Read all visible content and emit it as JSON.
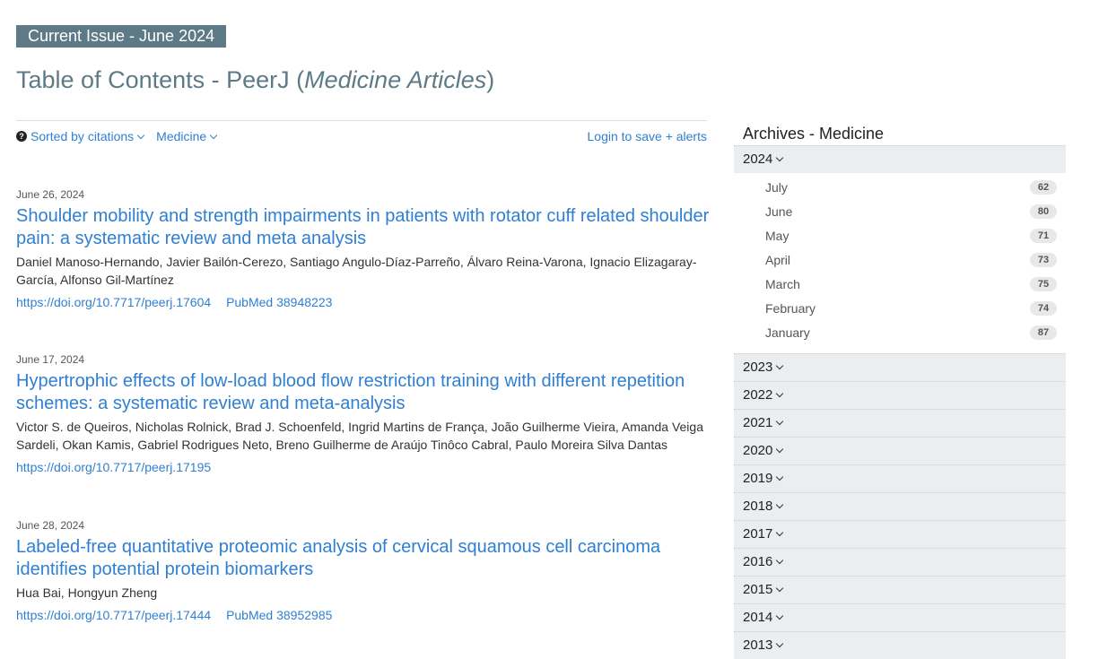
{
  "header": {
    "badge": "Current Issue - June 2024",
    "title_prefix": "Table of Contents - PeerJ (",
    "title_italic": "Medicine Articles",
    "title_suffix": ")"
  },
  "filters": {
    "help_glyph": "?",
    "sort_label": "Sorted by citations",
    "subject_label": "Medicine",
    "login_label": "Login to save + alerts"
  },
  "articles": [
    {
      "date": "June 26, 2024",
      "title": "Shoulder mobility and strength impairments in patients with rotator cuff related shoulder pain: a systematic review and meta analysis",
      "authors": "Daniel Manoso-Hernando, Javier Bailón-Cerezo, Santiago Angulo-Díaz-Parreño, Álvaro Reina-Varona, Ignacio Elizagaray-García, Alfonso Gil-Martínez",
      "doi": "https://doi.org/10.7717/peerj.17604",
      "pubmed": "PubMed 38948223"
    },
    {
      "date": "June 17, 2024",
      "title": "Hypertrophic effects of low-load blood flow restriction training with different repetition schemes: a systematic review and meta-analysis",
      "authors": "Victor S. de Queiros, Nicholas Rolnick, Brad J. Schoenfeld, Ingrid Martins de França, João Guilherme Vieira, Amanda Veiga Sardeli, Okan Kamis, Gabriel Rodrigues Neto, Breno Guilherme de Araújo Tinôco Cabral, Paulo Moreira Silva Dantas",
      "doi": "https://doi.org/10.7717/peerj.17195",
      "pubmed": ""
    },
    {
      "date": "June 28, 2024",
      "title": "Labeled-free quantitative proteomic analysis of cervical squamous cell carcinoma identifies potential protein biomarkers",
      "authors": "Hua Bai, Hongyun Zheng",
      "doi": "https://doi.org/10.7717/peerj.17444",
      "pubmed": "PubMed 38952985"
    }
  ],
  "archives": {
    "title": "Archives - Medicine",
    "expanded_year": "2024",
    "months": [
      {
        "name": "July",
        "count": "62"
      },
      {
        "name": "June",
        "count": "80"
      },
      {
        "name": "May",
        "count": "71"
      },
      {
        "name": "April",
        "count": "73"
      },
      {
        "name": "March",
        "count": "75"
      },
      {
        "name": "February",
        "count": "74"
      },
      {
        "name": "January",
        "count": "87"
      }
    ],
    "years": [
      "2023",
      "2022",
      "2021",
      "2020",
      "2019",
      "2018",
      "2017",
      "2016",
      "2015",
      "2014",
      "2013"
    ]
  }
}
